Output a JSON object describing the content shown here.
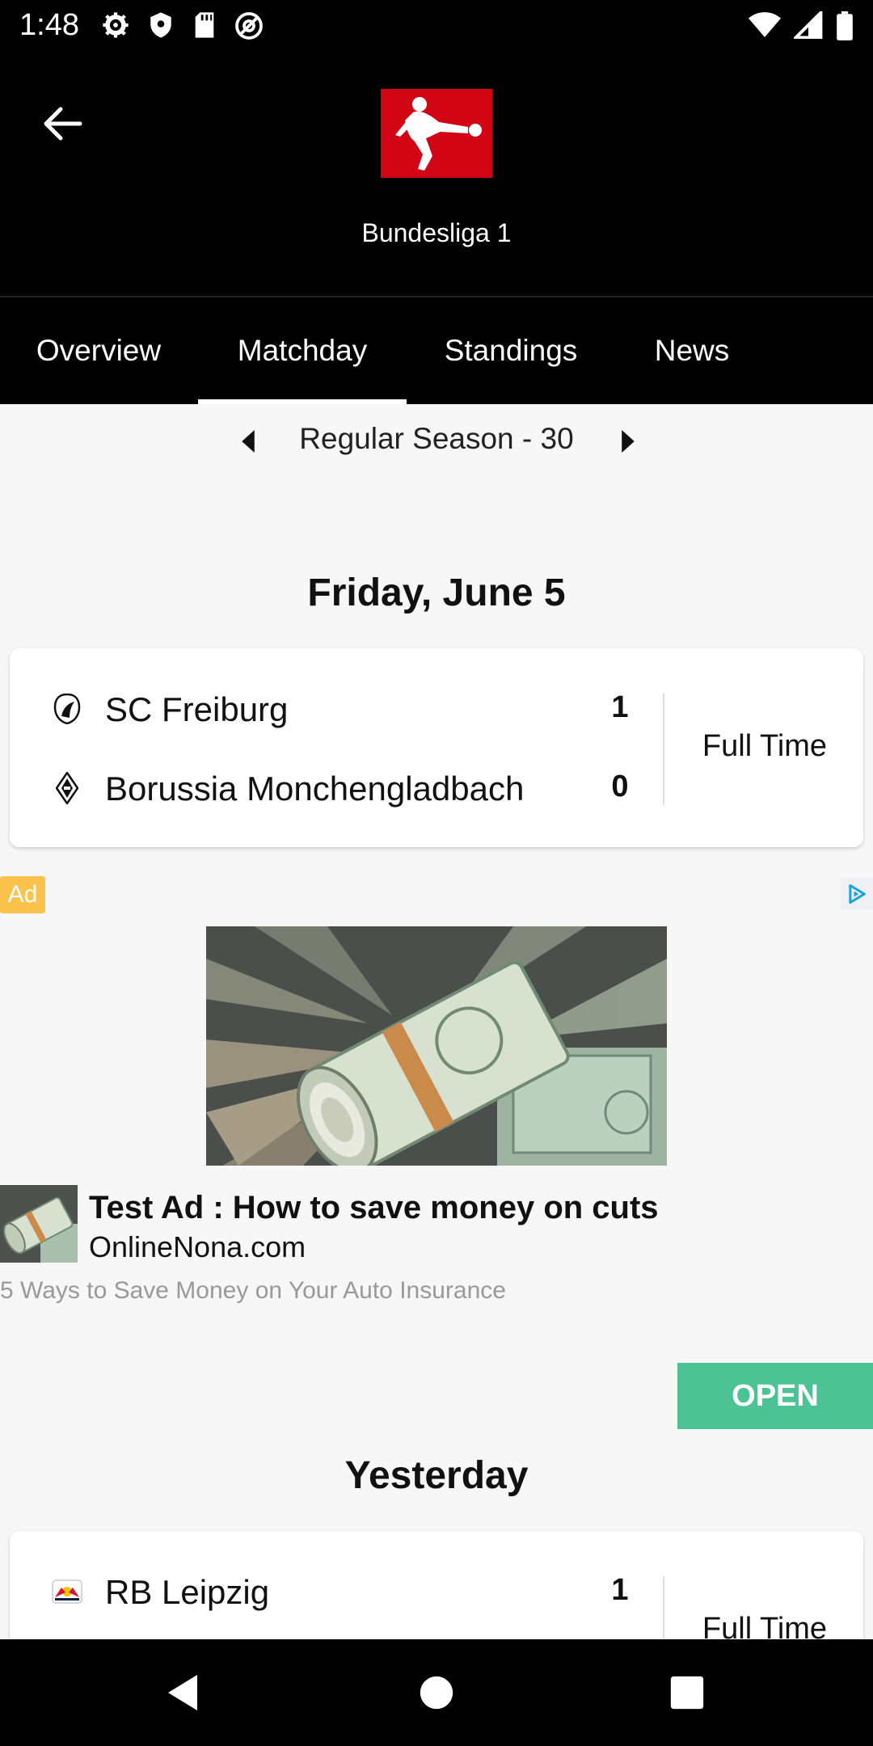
{
  "status_bar": {
    "time": "1:48",
    "left_icons": [
      "gear-icon",
      "shield-icon",
      "sd-card-icon",
      "at-sign-icon"
    ],
    "right_icons": [
      "wifi-icon",
      "cell-signal-icon",
      "battery-icon"
    ]
  },
  "header": {
    "league_name": "Bundesliga 1",
    "logo_color": "#d20515"
  },
  "tabs": [
    {
      "label": "Overview",
      "active": false
    },
    {
      "label": "Matchday",
      "active": true
    },
    {
      "label": "Standings",
      "active": false
    },
    {
      "label": "News",
      "active": false
    }
  ],
  "round": {
    "label": "Regular Season - 30"
  },
  "sections": [
    {
      "date": "Friday, June 5",
      "matches": [
        {
          "home": {
            "name": "SC Freiburg",
            "score": "1"
          },
          "away": {
            "name": "Borussia Monchengladbach",
            "score": "0"
          },
          "status": "Full Time"
        }
      ]
    },
    {
      "date": "Yesterday",
      "matches": [
        {
          "home": {
            "name": "RB Leipzig",
            "score": "1"
          },
          "status": "Full Time"
        }
      ]
    }
  ],
  "ad": {
    "badge": "Ad",
    "title": "Test Ad : How to save money on cuts",
    "domain": "OnlineNona.com",
    "description": "5 Ways to Save Money on Your Auto Insurance",
    "cta": "OPEN",
    "cta_color": "#4dc295",
    "badge_color": "#fbc34c"
  },
  "nav": {
    "icons": [
      "back-triangle-icon",
      "home-circle-icon",
      "recents-square-icon"
    ]
  }
}
